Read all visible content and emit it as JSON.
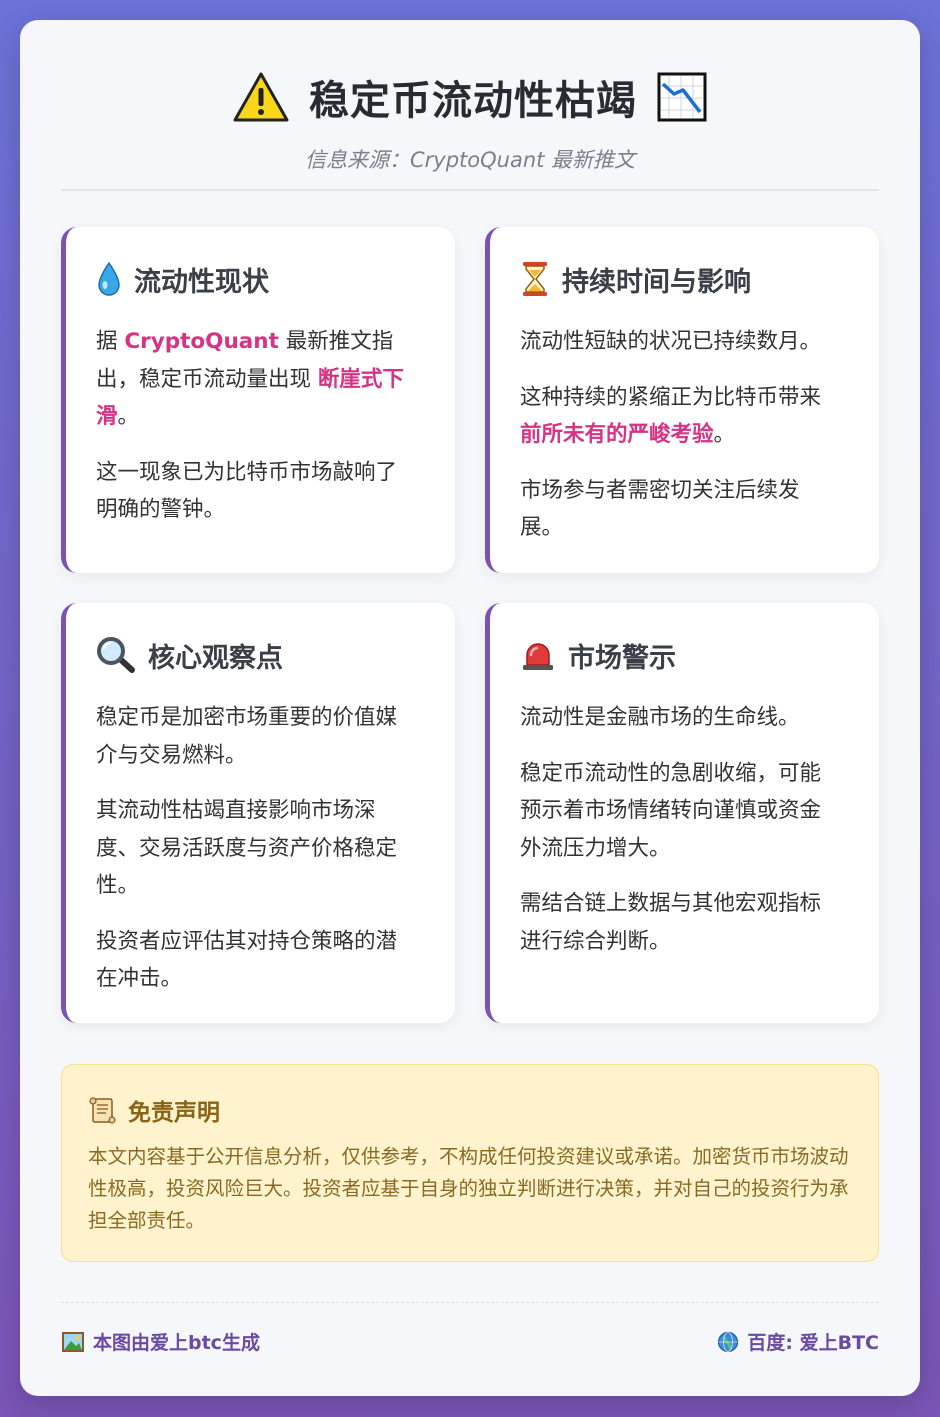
{
  "header": {
    "title": "稳定币流动性枯竭",
    "subtitle": "信息来源：CryptoQuant 最新推文"
  },
  "cards": [
    {
      "icon": "droplet-icon",
      "title": "流动性现状",
      "p1": {
        "a": "据 ",
        "b": "CryptoQuant",
        "c": " 最新推文指出，稳定币流动量出现 ",
        "d": "断崖式下滑",
        "e": "。"
      },
      "p2": "这一现象已为比特币市场敲响了明确的警钟。"
    },
    {
      "icon": "hourglass-icon",
      "title": "持续时间与影响",
      "p1": "流动性短缺的状况已持续数月。",
      "p2": {
        "a": "这种持续的紧缩正为比特币带来",
        "b": "前所未有的严峻考验",
        "c": "。"
      },
      "p3": "市场参与者需密切关注后续发展。"
    },
    {
      "icon": "magnifier-icon",
      "title": "核心观察点",
      "p1": "稳定币是加密市场重要的价值媒介与交易燃料。",
      "p2": "其流动性枯竭直接影响市场深度、交易活跃度与资产价格稳定性。",
      "p3": "投资者应评估其对持仓策略的潜在冲击。"
    },
    {
      "icon": "siren-icon",
      "title": "市场警示",
      "p1": "流动性是金融市场的生命线。",
      "p2": "稳定币流动性的急剧收缩，可能预示着市场情绪转向谨慎或资金外流压力增大。",
      "p3": "需结合链上数据与其他宏观指标进行综合判断。"
    }
  ],
  "disclaimer": {
    "title": "免责声明",
    "text": "本文内容基于公开信息分析，仅供参考，不构成任何投资建议或承诺。加密货币市场波动性极高，投资风险巨大。投资者应基于自身的独立判断进行决策，并对自己的投资行为承担全部责任。"
  },
  "footer": {
    "left": "本图由爱上btc生成",
    "right": "百度: 爱上BTC"
  },
  "colors": {
    "accent": "#7b52b0",
    "highlight": "#d63384",
    "disclaimer_bg": "#fef3cd"
  }
}
